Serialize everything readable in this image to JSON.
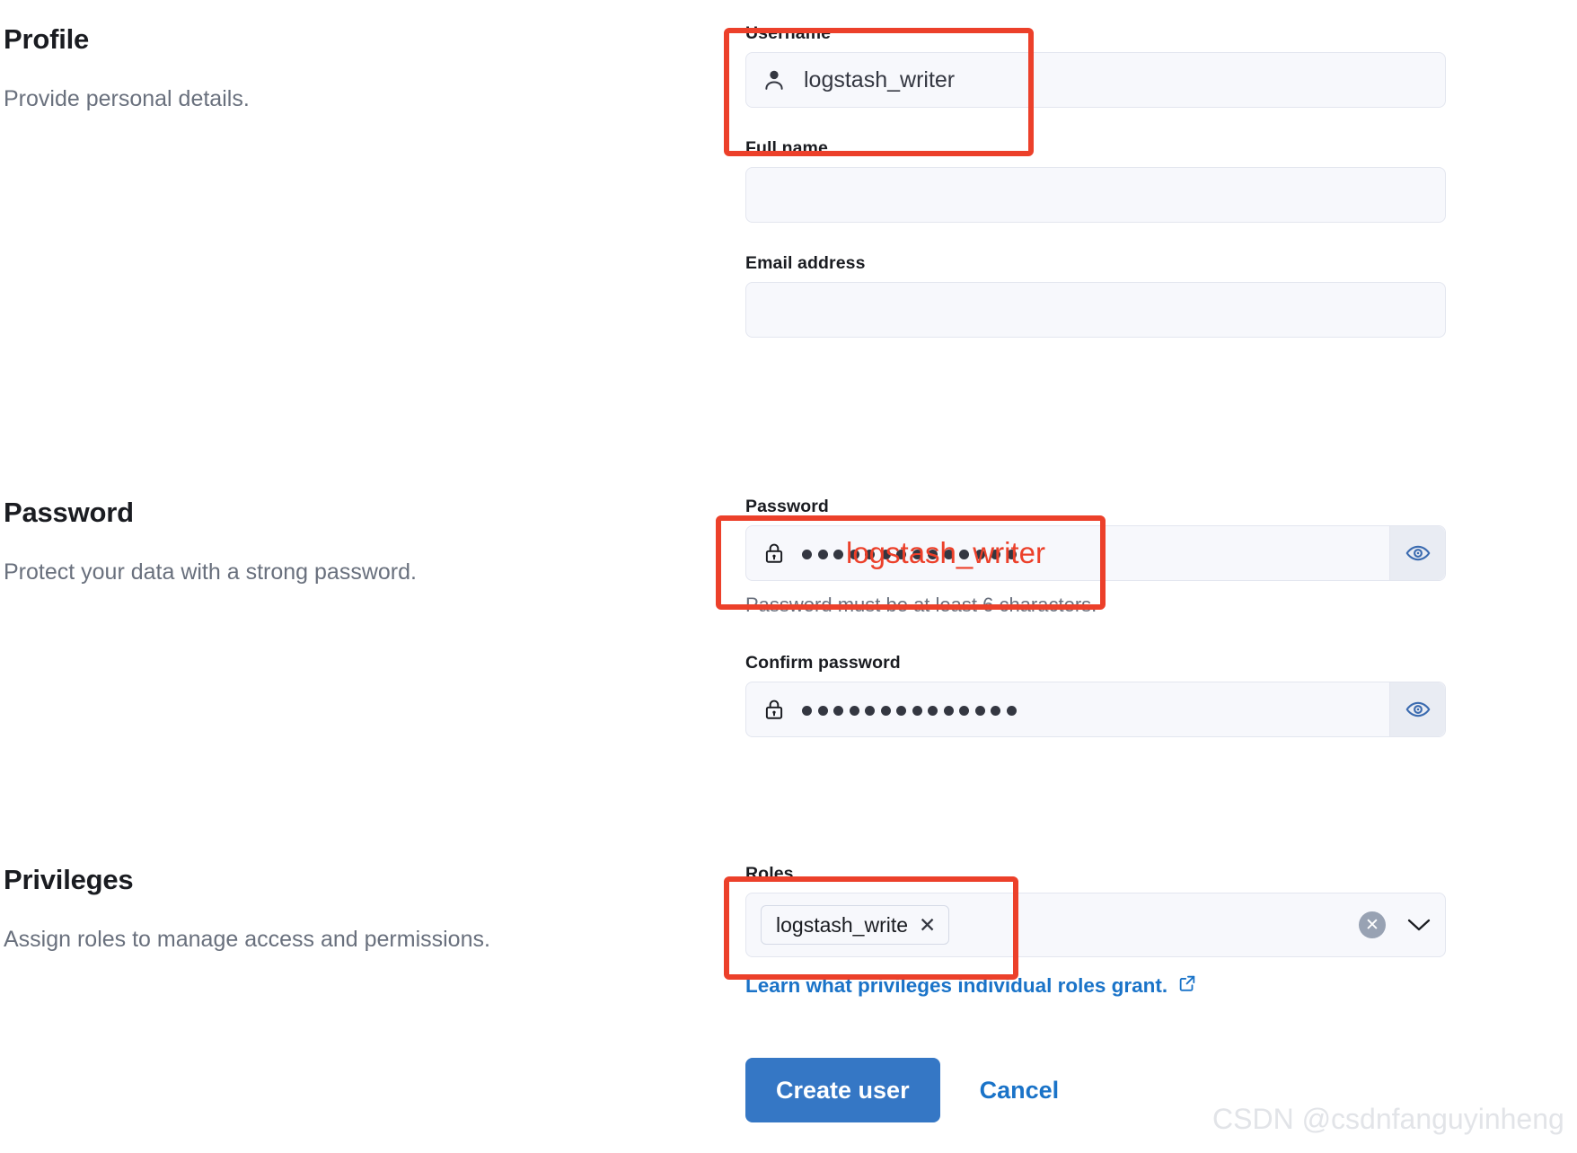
{
  "colors": {
    "annotation": "#ec402a",
    "primary_button": "#3577c5",
    "link": "#1a73c8",
    "field_bg": "#f7f8fc",
    "field_border": "#e3e6ef",
    "muted_text": "#69707d",
    "heading_text": "#1a1c21",
    "watermark": "#e2e4e8"
  },
  "sections": {
    "profile": {
      "title": "Profile",
      "description": "Provide personal details.",
      "fields": {
        "username": {
          "label": "Username",
          "value": "logstash_writer",
          "placeholder": "",
          "icon": "user-icon"
        },
        "full_name": {
          "label": "Full name",
          "value": "",
          "placeholder": ""
        },
        "email": {
          "label": "Email address",
          "value": "",
          "placeholder": ""
        }
      }
    },
    "password": {
      "title": "Password",
      "description": "Protect your data with a strong password.",
      "fields": {
        "password": {
          "label": "Password",
          "masked_char_count": 14,
          "icon": "lock-icon",
          "append_icon": "eye-icon",
          "help_text": "Password must be at least 6 characters."
        },
        "confirm_password": {
          "label": "Confirm password",
          "masked_char_count": 14,
          "icon": "lock-icon",
          "append_icon": "eye-icon"
        }
      }
    },
    "privileges": {
      "title": "Privileges",
      "description": "Assign roles to manage access and permissions.",
      "fields": {
        "roles": {
          "label": "Roles",
          "selected": [
            {
              "label": "logstash_write",
              "remove_icon": "close-icon"
            }
          ],
          "clear_icon": "clear-circle-icon",
          "chevron_icon": "chevron-down-icon"
        }
      },
      "link": {
        "text": "Learn what privileges individual roles grant.",
        "icon": "external-link-icon"
      }
    }
  },
  "actions": {
    "submit_label": "Create user",
    "cancel_label": "Cancel"
  },
  "annotations": {
    "password_note": "logstash_writer"
  },
  "watermark": {
    "text": "CSDN @csdnfanguyinheng"
  }
}
